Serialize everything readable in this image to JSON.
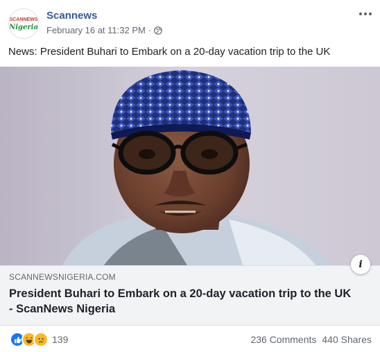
{
  "post": {
    "author": "Scannews",
    "avatar_text_top": "SCANNEWS",
    "avatar_text_bottom": "Nigeria",
    "timestamp": "February 16 at 11:32 PM",
    "separator": "·",
    "privacy_icon": "globe-icon",
    "more_icon": "more-options-icon",
    "caption": "News: President Buhari to Embark on a 20-day vacation trip to the UK"
  },
  "link_preview": {
    "domain": "SCANNEWSNIGERIA.COM",
    "title": "President Buhari to Embark on a 20-day vacation trip to the UK - ScanNews Nigeria",
    "info_label": "i",
    "image_icon": "news-photo"
  },
  "footer": {
    "reaction_icons": [
      "like-reaction-icon",
      "haha-reaction-icon",
      "sad-reaction-icon"
    ],
    "reaction_count": "139",
    "comments": "236 Comments",
    "shares": "440 Shares"
  },
  "colors": {
    "author": "#365899",
    "link_box_bg": "#f2f3f5",
    "like_blue": "#1877f2",
    "reaction_yellow": "#f7b928"
  }
}
